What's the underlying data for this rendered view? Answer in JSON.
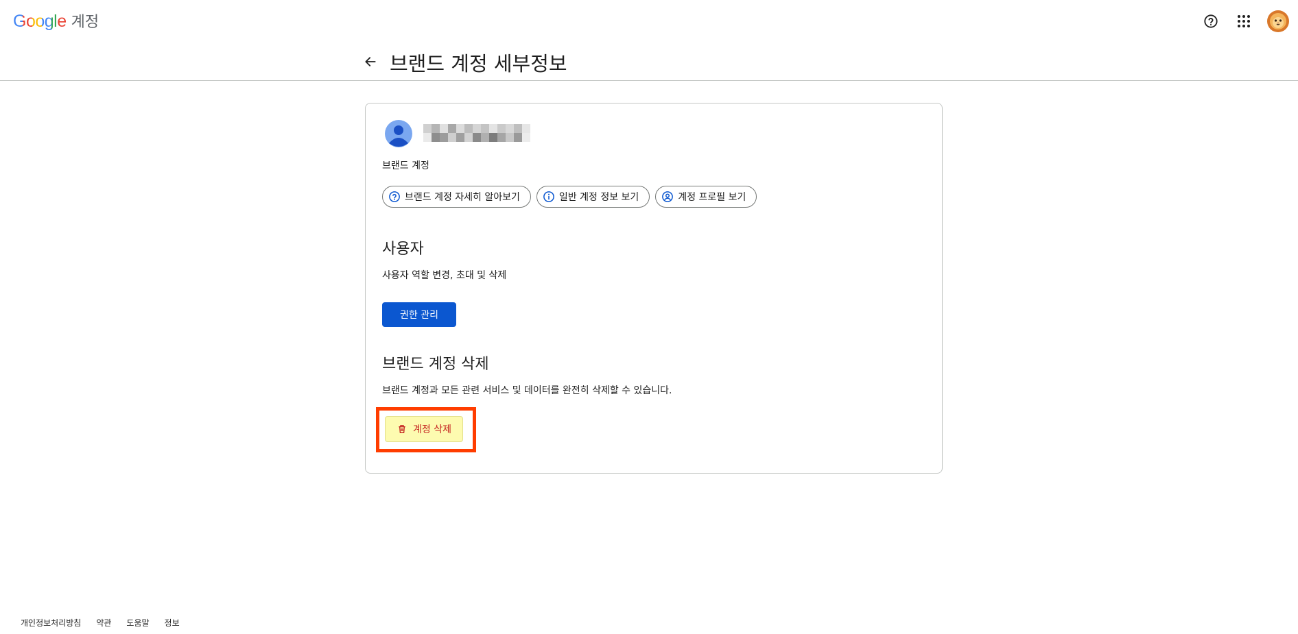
{
  "header": {
    "brand": "Google",
    "product": "계정",
    "icons": [
      "help-icon",
      "apps-icon",
      "account-avatar"
    ]
  },
  "titlebar": {
    "title": "브랜드 계정 세부정보"
  },
  "account": {
    "type_label": "브랜드 계정"
  },
  "chips": [
    {
      "label": "브랜드 계정 자세히 알아보기",
      "icon": "help-icon"
    },
    {
      "label": "일반 계정 정보 보기",
      "icon": "info-icon"
    },
    {
      "label": "계정 프로필 보기",
      "icon": "profile-icon"
    }
  ],
  "users_section": {
    "title": "사용자",
    "description": "사용자 역할 변경, 초대 및 삭제",
    "button_label": "권한 관리"
  },
  "delete_section": {
    "title": "브랜드 계정 삭제",
    "description": "브랜드 계정과 모든 관련 서비스 및 데이터를 완전히 삭제할 수 있습니다.",
    "button_label": "계정 삭제"
  },
  "footer": {
    "links": [
      "개인정보처리방침",
      "약관",
      "도움말",
      "정보"
    ]
  },
  "colors": {
    "primary": "#0b57d0",
    "highlight": "#ff3d00",
    "delete_text": "#c5221f",
    "delete_bg": "#fdfbb0"
  }
}
